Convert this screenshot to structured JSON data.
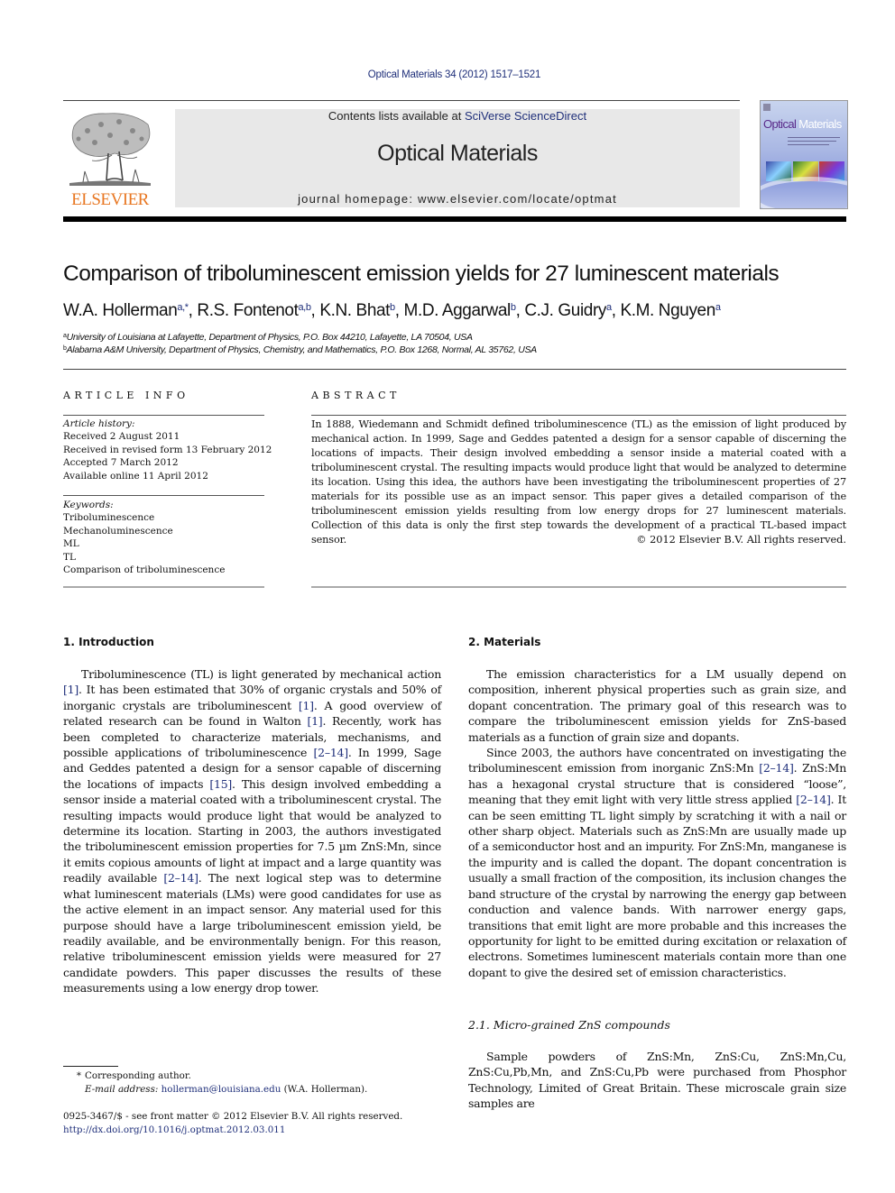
{
  "header": {
    "citation": "Optical Materials 34 (2012) 1517–1521",
    "contents_prefix": "Contents lists available at ",
    "contents_link": "SciVerse ScienceDirect",
    "journal_name": "Optical Materials",
    "homepage_prefix": "journal homepage: ",
    "homepage_url": "www.elsevier.com/locate/optmat",
    "publisher_logo_text": "ELSEVIER",
    "cover_title_word1": "Optical",
    "cover_title_word2": "Materials",
    "colors": {
      "link": "#1f2f7a",
      "elsevier_orange": "#e87722",
      "box_gray": "#e8e8e8"
    }
  },
  "article": {
    "title": "Comparison of triboluminescent emission yields for 27 luminescent materials",
    "authors": [
      {
        "name": "W.A. Hollerman",
        "sup": "a,*"
      },
      {
        "name": "R.S. Fontenot",
        "sup": "a,b"
      },
      {
        "name": "K.N. Bhat",
        "sup": "b"
      },
      {
        "name": "M.D. Aggarwal",
        "sup": "b"
      },
      {
        "name": "C.J. Guidry",
        "sup": "a"
      },
      {
        "name": "K.M. Nguyen",
        "sup": "a"
      }
    ],
    "affiliations": [
      {
        "mark": "a",
        "text": "University of Louisiana at Lafayette, Department of Physics, P.O. Box 44210, Lafayette, LA 70504, USA"
      },
      {
        "mark": "b",
        "text": "Alabama A&M University, Department of Physics, Chemistry, and Mathematics, P.O. Box 1268, Normal, AL 35762, USA"
      }
    ]
  },
  "article_info": {
    "heading": "ARTICLE INFO",
    "history_label": "Article history:",
    "history": [
      "Received 2 August 2011",
      "Received in revised form 13 February 2012",
      "Accepted 7 March 2012",
      "Available online 11 April 2012"
    ],
    "keywords_label": "Keywords:",
    "keywords": [
      "Triboluminescence",
      "Mechanoluminescence",
      "ML",
      "TL",
      "Comparison of triboluminescence"
    ]
  },
  "abstract": {
    "heading": "ABSTRACT",
    "text": "In 1888, Wiedemann and Schmidt defined triboluminescence (TL) as the emission of light produced by mechanical action. In 1999, Sage and Geddes patented a design for a sensor capable of discerning the locations of impacts. Their design involved embedding a sensor inside a material coated with a triboluminescent crystal. The resulting impacts would produce light that would be analyzed to determine its location. Using this idea, the authors have been investigating the triboluminescent properties of 27 materials for its possible use as an impact sensor. This paper gives a detailed comparison of the triboluminescent emission yields resulting from low energy drops for 27 luminescent materials. Collection of this data is only the first step towards the development of a practical TL-based impact sensor.",
    "copyright": "© 2012 Elsevier B.V. All rights reserved."
  },
  "section1": {
    "heading": "1. Introduction",
    "segments": [
      {
        "t": "Triboluminescence (TL) is light generated by mechanical action "
      },
      {
        "t": "[1]",
        "ref": true
      },
      {
        "t": ". It has been estimated that 30% of organic crystals and 50% of inorganic crystals are triboluminescent "
      },
      {
        "t": "[1]",
        "ref": true
      },
      {
        "t": ". A good overview of related research can be found in Walton "
      },
      {
        "t": "[1]",
        "ref": true
      },
      {
        "t": ". Recently, work has been completed to characterize materials, mechanisms, and possible applications of triboluminescence "
      },
      {
        "t": "[2–14]",
        "ref": true
      },
      {
        "t": ". In 1999, Sage and Geddes patented a design for a sensor capable of discerning the locations of impacts "
      },
      {
        "t": "[15]",
        "ref": true
      },
      {
        "t": ". This design involved embedding a sensor inside a material coated with a triboluminescent crystal. The resulting impacts would produce light that would be analyzed to determine its location. Starting in 2003, the authors investigated the triboluminescent emission properties for 7.5 µm ZnS:Mn, since it emits copious amounts of light at impact and a large quantity was readily available "
      },
      {
        "t": "[2–14]",
        "ref": true
      },
      {
        "t": ". The next logical step was to determine what luminescent materials (LMs) were good candidates for use as the active element in an impact sensor. Any material used for this purpose should have a large triboluminescent emission yield, be readily available, and be environmentally benign. For this reason, relative triboluminescent emission yields were measured for 27 candidate powders. This paper discusses the results of these measurements using a low energy drop tower."
      }
    ]
  },
  "section2": {
    "heading": "2. Materials",
    "paragraph1": "The emission characteristics for a LM usually depend on composition, inherent physical properties such as grain size, and dopant concentration. The primary goal of this research was to compare the triboluminescent emission yields for ZnS-based materials as a function of grain size and dopants.",
    "paragraph2_segments": [
      {
        "t": "Since 2003, the authors have concentrated on investigating the triboluminescent emission from inorganic ZnS:Mn "
      },
      {
        "t": "[2–14]",
        "ref": true
      },
      {
        "t": ". ZnS:Mn has a hexagonal crystal structure that is considered “loose”, meaning that they emit light with very little stress applied "
      },
      {
        "t": "[2–14]",
        "ref": true
      },
      {
        "t": ". It can be seen emitting TL light simply by scratching it with a nail or other sharp object. Materials such as ZnS:Mn are usually made up of a semiconductor host and an impurity. For ZnS:Mn, manganese is the impurity and is called the dopant. The dopant concentration is usually a small fraction of the composition, its inclusion changes the band structure of the crystal by narrowing the energy gap between conduction and valence bands. With narrower energy gaps, transitions that emit light are more probable and this increases the opportunity for light to be emitted during excitation or relaxation of electrons. Sometimes luminescent materials contain more than one dopant to give the desired set of emission characteristics."
      }
    ],
    "subsection_heading": "2.1. Micro-grained ZnS compounds",
    "subsection_text": "Sample powders of ZnS:Mn, ZnS:Cu, ZnS:Mn,Cu, ZnS:Cu,Pb,Mn, and ZnS:Cu,Pb were purchased from Phosphor Technology, Limited of Great Britain. These microscale grain size samples are"
  },
  "footnote": {
    "star": "*",
    "corresponding": "Corresponding author.",
    "email_label": "E-mail address:",
    "email": "hollerman@louisiana.edu",
    "email_suffix": " (W.A. Hollerman).",
    "issn_line": "0925-3467/$ - see front matter © 2012 Elsevier B.V. All rights reserved.",
    "doi": "http://dx.doi.org/10.1016/j.optmat.2012.03.011"
  }
}
